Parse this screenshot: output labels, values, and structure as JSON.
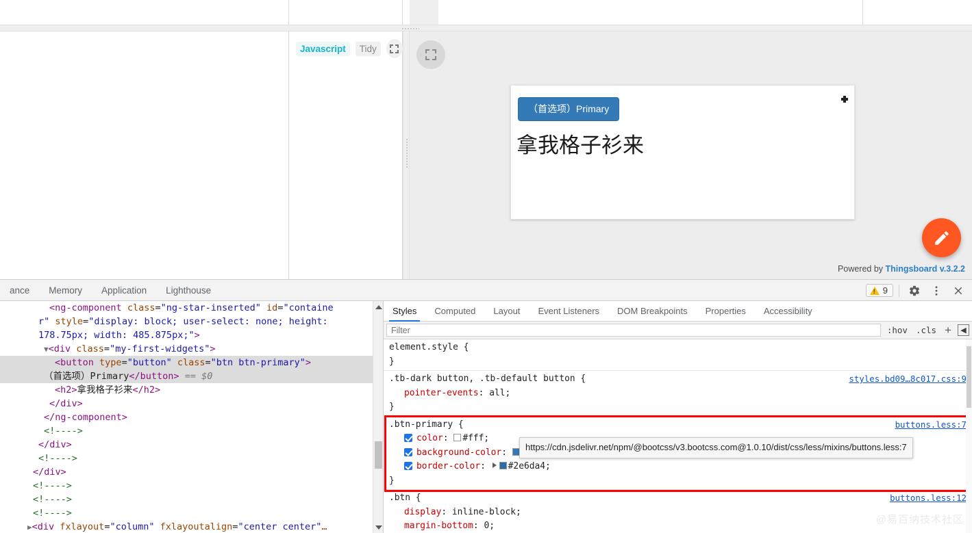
{
  "editor": {
    "language_chip": "Javascript",
    "tidy_button": "Tidy",
    "fullscreen_icon": "fullscreen-icon"
  },
  "preview": {
    "fullscreen_icon": "fullscreen-icon",
    "widget": {
      "button_label": "（首选项）Primary",
      "heading": "拿我格子衫来",
      "expand_icon": "expand-icon"
    },
    "powered_by_prefix": "Powered by",
    "powered_by_link": "Thingsboard v.3.2.2",
    "edit_fab_icon": "pencil-icon"
  },
  "devtools": {
    "tabs": [
      {
        "label": "ance"
      },
      {
        "label": "Memory"
      },
      {
        "label": "Application"
      },
      {
        "label": "Lighthouse"
      }
    ],
    "warning_count": "9",
    "settings_icon": "gear-icon",
    "more_icon": "kebab-menu-icon",
    "close_icon": "close-icon",
    "dom": {
      "lines": [
        {
          "indent": 9,
          "html": "<span class=\"tg\">&lt;ng-component</span> <span class=\"at\">class</span>=<span class=\"av\">\"ng-star-inserted\"</span> <span class=\"at\">id</span>=<span class=\"av\">\"containe</span>",
          "selected": false
        },
        {
          "indent": 7,
          "html": "<span class=\"av\">r\"</span> <span class=\"at\">style</span>=<span class=\"av\">\"display: block; user-select: none; height:</span>",
          "selected": false
        },
        {
          "indent": 7,
          "html": "<span class=\"av\">178.75px; width: 485.875px;\"</span><span class=\"tg\">&gt;</span>",
          "selected": false
        },
        {
          "indent": 8,
          "html": "<span class=\"arrow\">▼</span><span class=\"tg\">&lt;div</span> <span class=\"at\">class</span>=<span class=\"av\">\"my-first-widgets\"</span><span class=\"tg\">&gt;</span>",
          "selected": false
        },
        {
          "indent": 10,
          "html": "<span class=\"tg\">&lt;button</span> <span class=\"at\">type</span>=<span class=\"av\">\"button\"</span> <span class=\"at\">class</span>=<span class=\"av\">\"btn btn-primary\"</span><span class=\"tg\">&gt;</span>",
          "selected": true
        },
        {
          "indent": 8,
          "html": "<span class=\"txt\">（首选项）Primary</span><span class=\"tg\">&lt;/button&gt;</span> <span class=\"dollar\">== $0</span>",
          "selected": true
        },
        {
          "indent": 10,
          "html": "<span class=\"tg\">&lt;h2&gt;</span><span class=\"txt\">拿我格子衫来</span><span class=\"tg\">&lt;/h2&gt;</span>",
          "selected": false
        },
        {
          "indent": 9,
          "html": "<span class=\"tg\">&lt;/div&gt;</span>",
          "selected": false
        },
        {
          "indent": 8,
          "html": "<span class=\"tg\">&lt;/ng-component&gt;</span>",
          "selected": false
        },
        {
          "indent": 8,
          "html": "<span class=\"cm\">&lt;!----&gt;</span>",
          "selected": false
        },
        {
          "indent": 7,
          "html": "<span class=\"tg\">&lt;/div&gt;</span>",
          "selected": false
        },
        {
          "indent": 7,
          "html": "<span class=\"cm\">&lt;!----&gt;</span>",
          "selected": false
        },
        {
          "indent": 6,
          "html": "<span class=\"tg\">&lt;/div&gt;</span>",
          "selected": false
        },
        {
          "indent": 6,
          "html": "<span class=\"cm\">&lt;!----&gt;</span>",
          "selected": false
        },
        {
          "indent": 6,
          "html": "<span class=\"cm\">&lt;!----&gt;</span>",
          "selected": false
        },
        {
          "indent": 6,
          "html": "<span class=\"cm\">&lt;!----&gt;</span>",
          "selected": false
        },
        {
          "indent": 5,
          "html": "<span class=\"arrow\">▶</span><span class=\"tg\">&lt;div</span> <span class=\"at\">fxlayout</span>=<span class=\"av\">\"column\"</span> <span class=\"at\">fxlayoutalign</span>=<span class=\"av\">\"center center\"</span><span class=\"at\">…</span>",
          "selected": false
        }
      ]
    },
    "styles": {
      "tabs": [
        {
          "label": "Styles",
          "active": true
        },
        {
          "label": "Computed",
          "active": false
        },
        {
          "label": "Layout",
          "active": false
        },
        {
          "label": "Event Listeners",
          "active": false
        },
        {
          "label": "DOM Breakpoints",
          "active": false
        },
        {
          "label": "Properties",
          "active": false
        },
        {
          "label": "Accessibility",
          "active": false
        }
      ],
      "filter_placeholder": "Filter",
      "filter_value": "",
      "hov_label": ":hov",
      "cls_label": ".cls",
      "new_rule_label": "+",
      "sidebar_toggle_icon": "panel-toggle-icon",
      "rules": [
        {
          "selector": "element.style {",
          "source": "",
          "declarations": [],
          "closing": "}"
        },
        {
          "selector": ".tb-dark button, .tb-default button {",
          "source": "styles.bd09…8c017.css:9",
          "declarations": [
            {
              "checkbox": false,
              "property": "pointer-events",
              "value": "all;",
              "swatch": ""
            }
          ],
          "closing": "}"
        },
        {
          "selector": ".btn-primary {",
          "source": "buttons.less:7",
          "highlighted": true,
          "declarations": [
            {
              "checkbox": true,
              "property": "color",
              "value": "#fff;",
              "swatch": "#ffffff"
            },
            {
              "checkbox": true,
              "property": "background-color",
              "value": "",
              "swatch": "#337ab7"
            },
            {
              "checkbox": true,
              "property": "border-color",
              "value": "#2e6da4;",
              "swatch": "#2e6da4",
              "expandable": true
            }
          ],
          "closing": "}"
        },
        {
          "selector": ".btn {",
          "source": "buttons.less:12",
          "declarations": [
            {
              "checkbox": false,
              "property": "display",
              "value": "inline-block;",
              "swatch": ""
            },
            {
              "checkbox": false,
              "property": "margin-bottom",
              "value": "0;",
              "swatch": ""
            }
          ],
          "closing": ""
        }
      ],
      "tooltip_url": "https://cdn.jsdelivr.net/npm/@bootcss/v3.bootcss.com@1.0.10/dist/css/less/mixins/buttons.less:7"
    }
  },
  "watermark": "@易百纳技术社区",
  "colors": {
    "accent": "#1a73e8",
    "primary_button_bg": "#337ab7",
    "primary_button_border": "#2e6da4",
    "fab": "#ff5722",
    "highlight_box": "#ff0000",
    "warning": "#fbbc04"
  }
}
